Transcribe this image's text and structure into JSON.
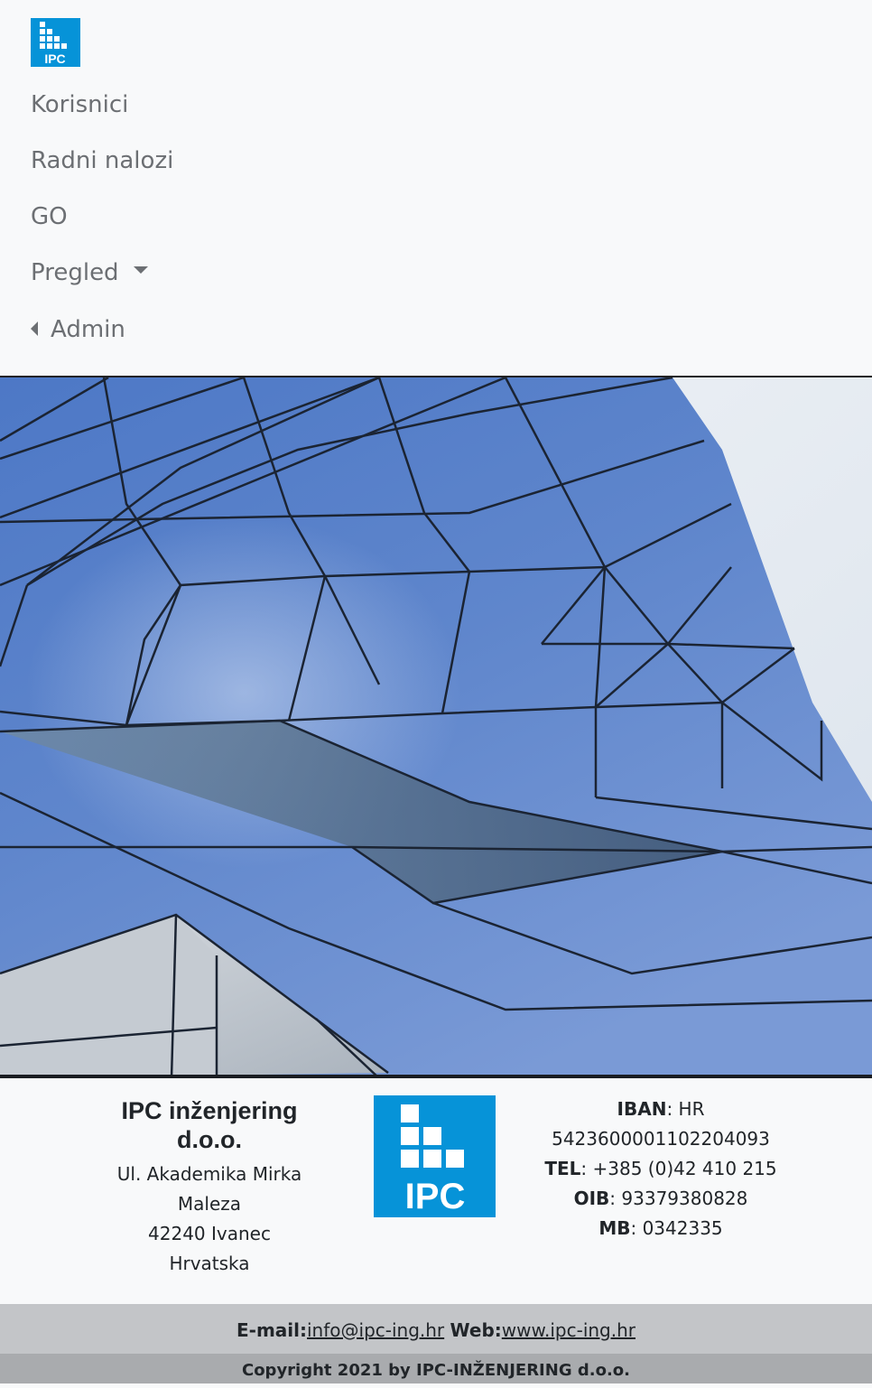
{
  "nav": {
    "logo_text": "IPC",
    "items": [
      {
        "label": "Korisnici"
      },
      {
        "label": "Radni nalozi"
      },
      {
        "label": "GO"
      },
      {
        "label": "Pregled"
      },
      {
        "label": "Admin"
      }
    ]
  },
  "footer": {
    "company": "IPC inženjering d.o.o.",
    "address": [
      "Ul. Akademika Mirka Maleza",
      "42240 Ivanec",
      "Hrvatska"
    ],
    "logo_text": "IPC",
    "iban_label": "IBAN",
    "iban_value": ": HR 5423600001102204093",
    "tel_label": "TEL",
    "tel_value": ": +385 (0)42 410 215",
    "oib_label": "OIB",
    "oib_value": ": 93379380828",
    "mb_label": "MB",
    "mb_value": ": 0342335",
    "email_label": "E-mail:",
    "email": "info@ipc-ing.hr",
    "web_label": "Web:",
    "web": "www.ipc-ing.hr",
    "copyright": "Copyright 2021 by IPC-INŽENJERING d.o.o."
  },
  "colors": {
    "brand_blue": "#0693d8",
    "nav_text": "#6c6f73",
    "contact_bar": "#c3c5c8",
    "copyright_bar": "#a9abae"
  }
}
